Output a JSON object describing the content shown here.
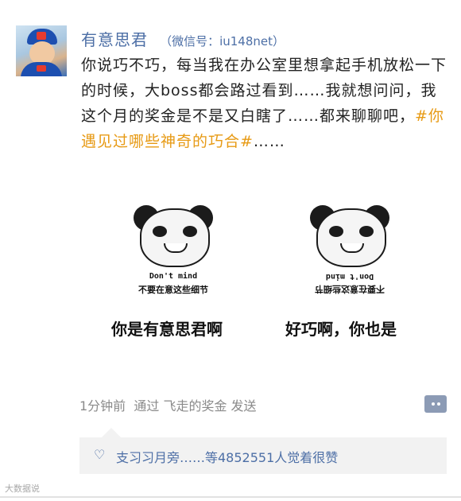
{
  "post": {
    "username": "有意思君",
    "wechat_id": "（微信号：iu148net）",
    "text_main": "你说巧不巧，每当我在办公室里想拿起手机放松一下的时候，大boss都会路过看到……我就想问问，我这个月的奖金是不是又白瞎了……都来聊聊吧，",
    "hashtag": "#你遇见过哪些神奇的巧合#",
    "text_tail": "……"
  },
  "memes": {
    "left": {
      "caption_en": "Don't mind",
      "caption_zh": "不要在意这些细节",
      "label": "你是有意思君啊"
    },
    "right": {
      "caption_en": "Don't mind",
      "caption_zh": "不要在意这些细节",
      "label": "好巧啊，你也是"
    }
  },
  "meta": {
    "time": "1分钟前",
    "via_text": "通过 飞走的奖金 发送"
  },
  "likes": {
    "text": "支习习月旁……等4852551人觉着很赞"
  },
  "watermark": {
    "text": "大数据说"
  },
  "colors": {
    "link_blue": "#4d6fa6",
    "hashtag_orange": "#e79a14"
  }
}
